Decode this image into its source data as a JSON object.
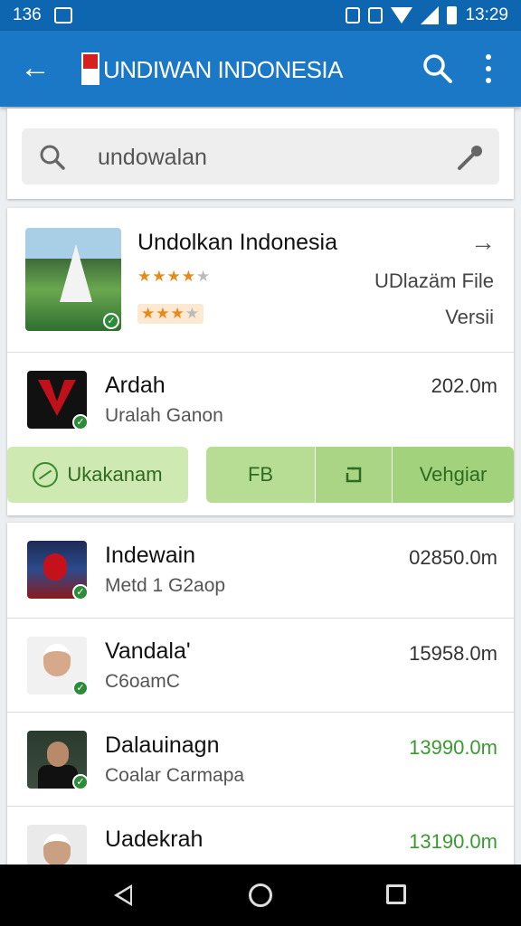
{
  "status_bar": {
    "left_text": "136",
    "time": "13:29"
  },
  "app_bar": {
    "title": "UNDIWAN INDONESIA",
    "flag_colors": [
      "#d62020",
      "#ffffff"
    ]
  },
  "search": {
    "query": "undowalan",
    "icons": [
      "search-icon",
      "mic-icon"
    ]
  },
  "featured": {
    "title": "Undolkan Indonesia",
    "rating_primary": 3.5,
    "rating_secondary": 3,
    "meta_line_1": "UDlazäm File",
    "meta_line_2": "Versii"
  },
  "first_item": {
    "name": "Ardah",
    "subtitle": "Uralah Ganon",
    "size": "202.0m"
  },
  "actions": {
    "primary": "Ukakanam",
    "fb": "FB",
    "mid_icon": "square-arrow-icon",
    "last": "Vehgiar"
  },
  "list": [
    {
      "name": "Indewain",
      "subtitle": "Metd 1 G2aop",
      "size": "02850.0m",
      "highlight": false
    },
    {
      "name": "Vandala'",
      "subtitle": "C6oamC",
      "size": "15958.0m",
      "highlight": false
    },
    {
      "name": "Dalauinagn",
      "subtitle": "Coalar Carmapa",
      "size": "13990.0m",
      "highlight": true
    },
    {
      "name": "Uadekrah",
      "subtitle": "",
      "size": "13190.0m",
      "highlight": true
    }
  ],
  "colors": {
    "status_bar": "#0e66b0",
    "app_bar": "#1a78c6",
    "accent_green": "#3a9a2f",
    "star": "#e88a1a"
  }
}
